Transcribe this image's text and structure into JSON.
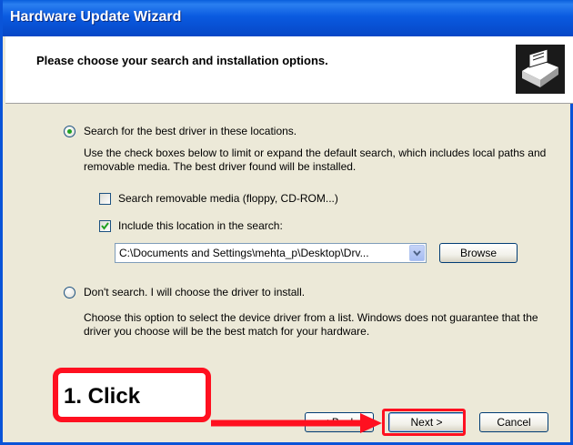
{
  "window": {
    "title": "Hardware Update Wizard"
  },
  "header": {
    "heading": "Please choose your search and installation options.",
    "icon": "hardware-icon"
  },
  "search_option": {
    "label": "Search for the best driver in these locations.",
    "selected": true,
    "description": "Use the check boxes below to limit or expand the default search, which includes local paths and removable media. The best driver found will be installed.",
    "removable_media": {
      "label": "Search removable media (floppy, CD-ROM...)",
      "checked": false
    },
    "include_location": {
      "label": "Include this location in the search:",
      "checked": true
    },
    "location_value": "C:\\Documents and Settings\\mehta_p\\Desktop\\Drv...",
    "browse_label": "Browse"
  },
  "dont_search_option": {
    "label": "Don't search. I will choose the driver to install.",
    "selected": false,
    "description": "Choose this option to select the device driver from a list.  Windows does not guarantee that the driver you choose will be the best match for your hardware."
  },
  "buttons": {
    "back_label": "< Back",
    "next_label": "Next >",
    "cancel_label": "Cancel"
  },
  "annotation": {
    "text": "1. Click",
    "color": "#ff1020"
  }
}
